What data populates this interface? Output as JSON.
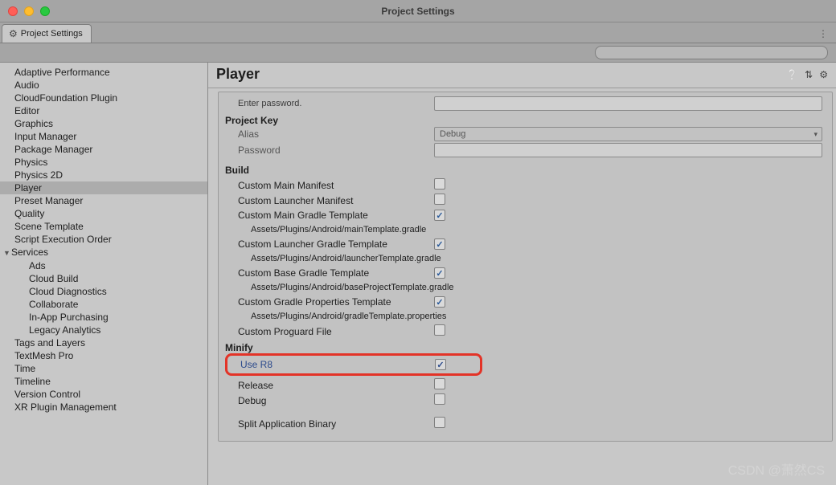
{
  "window": {
    "title": "Project Settings"
  },
  "tab": {
    "label": "Project Settings"
  },
  "search": {
    "placeholder": ""
  },
  "sidebar": {
    "items": [
      {
        "label": "Adaptive Performance",
        "selected": false
      },
      {
        "label": "Audio",
        "selected": false
      },
      {
        "label": "CloudFoundation Plugin",
        "selected": false
      },
      {
        "label": "Editor",
        "selected": false
      },
      {
        "label": "Graphics",
        "selected": false
      },
      {
        "label": "Input Manager",
        "selected": false
      },
      {
        "label": "Package Manager",
        "selected": false
      },
      {
        "label": "Physics",
        "selected": false
      },
      {
        "label": "Physics 2D",
        "selected": false
      },
      {
        "label": "Player",
        "selected": true
      },
      {
        "label": "Preset Manager",
        "selected": false
      },
      {
        "label": "Quality",
        "selected": false
      },
      {
        "label": "Scene Template",
        "selected": false
      },
      {
        "label": "Script Execution Order",
        "selected": false
      },
      {
        "label": "Services",
        "selected": false,
        "expandable": true,
        "expanded": true
      },
      {
        "label": "Ads",
        "selected": false,
        "child": true
      },
      {
        "label": "Cloud Build",
        "selected": false,
        "child": true
      },
      {
        "label": "Cloud Diagnostics",
        "selected": false,
        "child": true
      },
      {
        "label": "Collaborate",
        "selected": false,
        "child": true
      },
      {
        "label": "In-App Purchasing",
        "selected": false,
        "child": true
      },
      {
        "label": "Legacy Analytics",
        "selected": false,
        "child": true
      },
      {
        "label": "Tags and Layers",
        "selected": false
      },
      {
        "label": "TextMesh Pro",
        "selected": false
      },
      {
        "label": "Time",
        "selected": false
      },
      {
        "label": "Timeline",
        "selected": false
      },
      {
        "label": "Version Control",
        "selected": false
      },
      {
        "label": "XR Plugin Management",
        "selected": false
      }
    ]
  },
  "panel": {
    "title": "Player",
    "enter_password_hint": "Enter password.",
    "project_key_header": "Project Key",
    "alias_label": "Alias",
    "alias_value": "Debug",
    "password_label": "Password",
    "build_header": "Build",
    "rows": {
      "custom_main_manifest": {
        "label": "Custom Main Manifest",
        "checked": false
      },
      "custom_launcher_manifest": {
        "label": "Custom Launcher Manifest",
        "checked": false
      },
      "custom_main_gradle": {
        "label": "Custom Main Gradle Template",
        "checked": true,
        "path": "Assets/Plugins/Android/mainTemplate.gradle"
      },
      "custom_launcher_gradle": {
        "label": "Custom Launcher Gradle Template",
        "checked": true,
        "path": "Assets/Plugins/Android/launcherTemplate.gradle"
      },
      "custom_base_gradle": {
        "label": "Custom Base Gradle Template",
        "checked": true,
        "path": "Assets/Plugins/Android/baseProjectTemplate.gradle"
      },
      "custom_gradle_props": {
        "label": "Custom Gradle Properties Template",
        "checked": true,
        "path": "Assets/Plugins/Android/gradleTemplate.properties"
      },
      "custom_proguard": {
        "label": "Custom Proguard File",
        "checked": false
      }
    },
    "minify_header": "Minify",
    "minify": {
      "use_r8": {
        "label": "Use R8",
        "checked": true
      },
      "release": {
        "label": "Release",
        "checked": false
      },
      "debug": {
        "label": "Debug",
        "checked": false
      }
    },
    "split_app_binary": {
      "label": "Split Application Binary",
      "checked": false
    }
  },
  "watermark": "CSDN @萧然CS"
}
